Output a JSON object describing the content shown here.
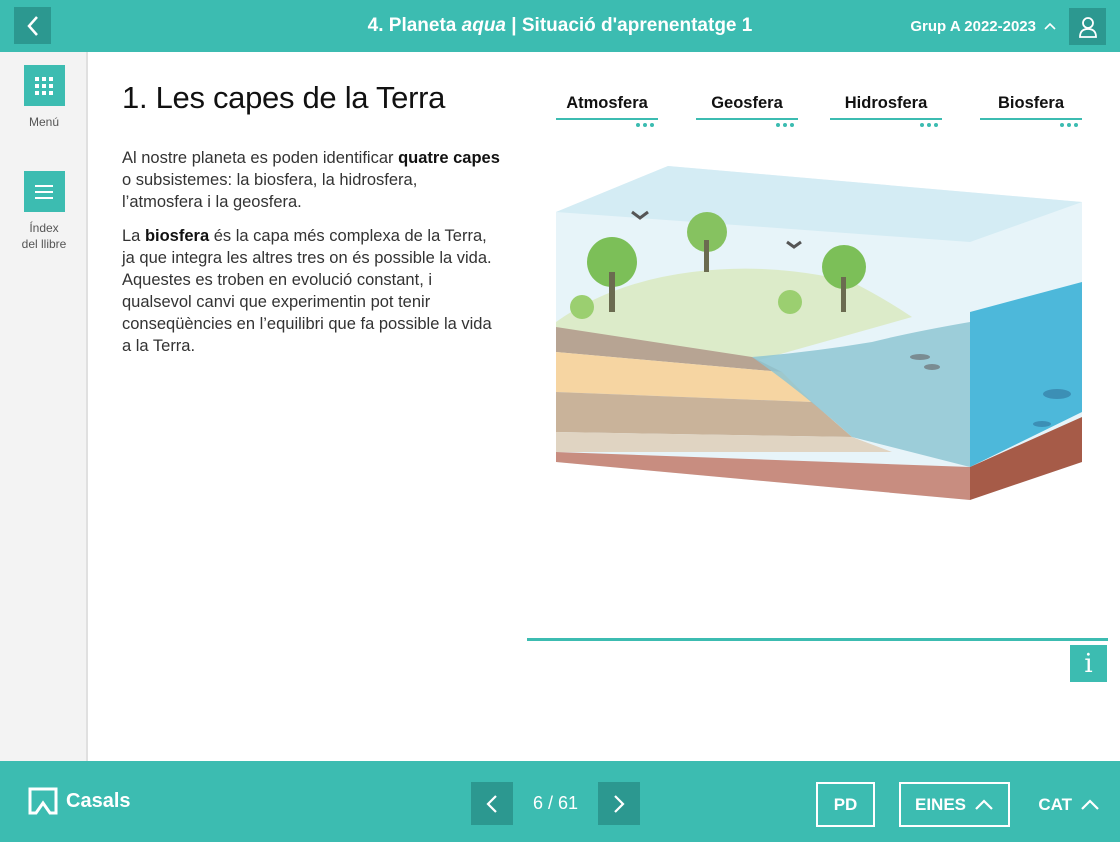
{
  "header": {
    "title_prefix": "4. Planeta ",
    "title_italic": "aqua",
    "title_suffix": " | Situació d'aprenentatge 1",
    "group": "Grup A 2022-2023"
  },
  "sidebar": {
    "items": [
      {
        "label": "Menú",
        "icon": "grid-icon"
      },
      {
        "label_line1": "Índex",
        "label_line2": "del llibre",
        "icon": "list-icon"
      }
    ]
  },
  "main": {
    "title": "1. Les capes de la Terra",
    "para1": {
      "t1": "Al nostre planeta es poden identificar ",
      "b1": "quatre capes",
      "t2": " o subsistemes: la biosfera, la hidrosfera, l’atmosfera i la geosfera."
    },
    "para2": {
      "t1": "La ",
      "b1": "biosfera",
      "t2": " és la capa més complexa de la Terra, ja que integra les altres tres on és possible la vida. Aquestes es troben en evolució constant, i qualsevol canvi que experimentin pot tenir conseqüències en l’equilibri que fa possible la vida a la Terra."
    },
    "tabs": [
      "Atmosfera",
      "Geosfera",
      "Hidrosfera",
      "Biosfera"
    ],
    "info_label": "i"
  },
  "footer": {
    "brand": "Casals",
    "page_indicator": "6 / 61",
    "pd_label": "PD",
    "eines_label": "EINES",
    "lang_label": "CAT"
  },
  "colors": {
    "accent": "#3cbcb1",
    "accent_dark": "#2c9890"
  }
}
